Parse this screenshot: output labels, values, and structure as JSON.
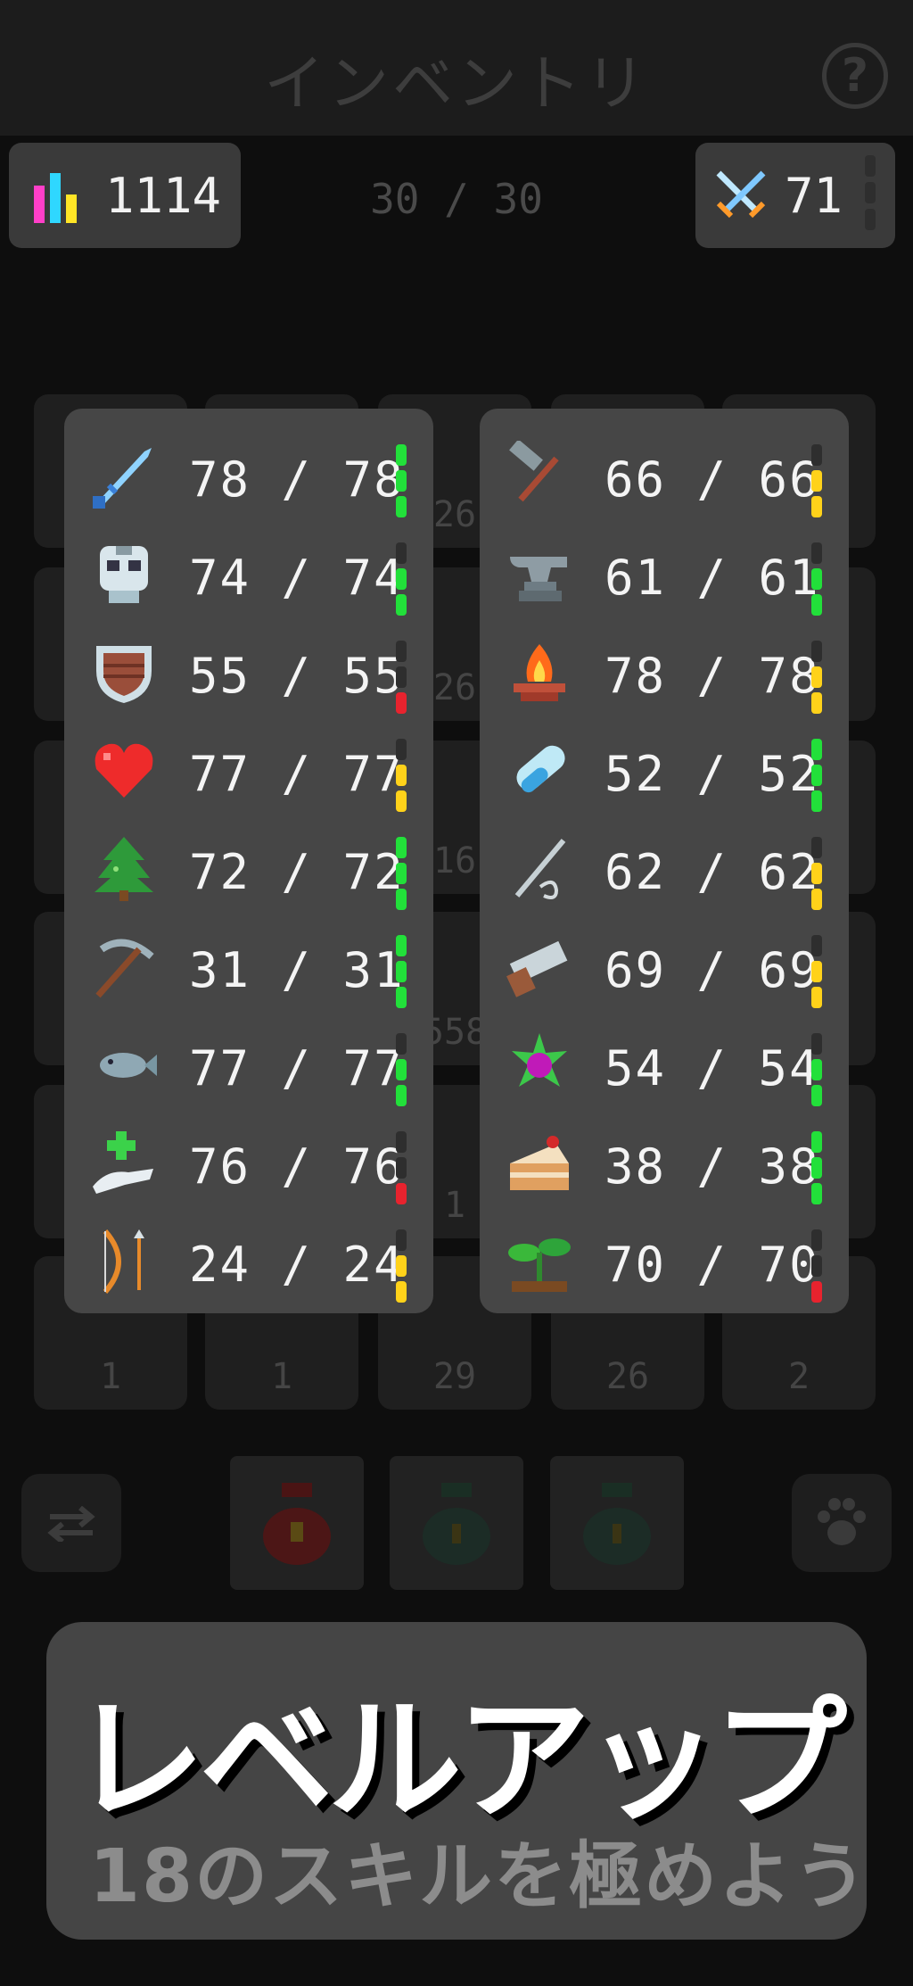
{
  "header": {
    "title": "インベントリ",
    "help_glyph": "?"
  },
  "stats": {
    "total_level": "1114",
    "combat_level": "71",
    "capacity": "30 / 30"
  },
  "background_counts": [
    "26",
    "26",
    "16",
    "558",
    "1",
    "1",
    "1",
    "29",
    "26",
    "2"
  ],
  "skills_left": [
    {
      "icon": "sword-icon",
      "value": "78 / 78",
      "bar": {
        "level_fraction": 1.0,
        "color": "#22e03a"
      }
    },
    {
      "icon": "skull-helmet-icon",
      "value": "74 / 74",
      "bar": {
        "level_fraction": 0.75,
        "color": "#22e03a"
      }
    },
    {
      "icon": "shield-icon",
      "value": "55 / 55",
      "bar": {
        "level_fraction": 0.25,
        "color": "#e8232e"
      }
    },
    {
      "icon": "heart-icon",
      "value": "77 / 77",
      "bar": {
        "level_fraction": 0.5,
        "color": "#ffd21a"
      }
    },
    {
      "icon": "tree-icon",
      "value": "72 / 72",
      "bar": {
        "level_fraction": 1.0,
        "color": "#22e03a"
      }
    },
    {
      "icon": "pickaxe-icon",
      "value": "31 / 31",
      "bar": {
        "level_fraction": 1.0,
        "color": "#22e03a"
      }
    },
    {
      "icon": "fish-icon",
      "value": "77 / 77",
      "bar": {
        "level_fraction": 0.75,
        "color": "#22e03a"
      }
    },
    {
      "icon": "healing-hand-icon",
      "value": "76 / 76",
      "bar": {
        "level_fraction": 0.25,
        "color": "#e8232e"
      }
    },
    {
      "icon": "bow-icon",
      "value": "24 / 24",
      "bar": {
        "level_fraction": 0.5,
        "color": "#ffd21a"
      }
    }
  ],
  "skills_right": [
    {
      "icon": "hammer-icon",
      "value": "66 / 66",
      "bar": {
        "level_fraction": 0.5,
        "color": "#ffd21a"
      }
    },
    {
      "icon": "anvil-icon",
      "value": "61 / 61",
      "bar": {
        "level_fraction": 0.75,
        "color": "#22e03a"
      }
    },
    {
      "icon": "campfire-icon",
      "value": "78 / 78",
      "bar": {
        "level_fraction": 0.5,
        "color": "#ffd21a"
      }
    },
    {
      "icon": "potion-vial-icon",
      "value": "52 / 52",
      "bar": {
        "level_fraction": 1.0,
        "color": "#22e03a"
      }
    },
    {
      "icon": "needle-icon",
      "value": "62 / 62",
      "bar": {
        "level_fraction": 0.5,
        "color": "#ffd21a"
      }
    },
    {
      "icon": "saw-icon",
      "value": "69 / 69",
      "bar": {
        "level_fraction": 0.5,
        "color": "#ffd21a"
      }
    },
    {
      "icon": "magic-gem-icon",
      "value": "54 / 54",
      "bar": {
        "level_fraction": 0.75,
        "color": "#22e03a"
      }
    },
    {
      "icon": "cake-icon",
      "value": "38 / 38",
      "bar": {
        "level_fraction": 1.0,
        "color": "#22e03a"
      }
    },
    {
      "icon": "sprout-icon",
      "value": "70 / 70",
      "bar": {
        "level_fraction": 0.25,
        "color": "#e8232e"
      }
    }
  ],
  "promo": {
    "title": "レベルアップ",
    "subtitle": "18のスキルを極めよう"
  }
}
